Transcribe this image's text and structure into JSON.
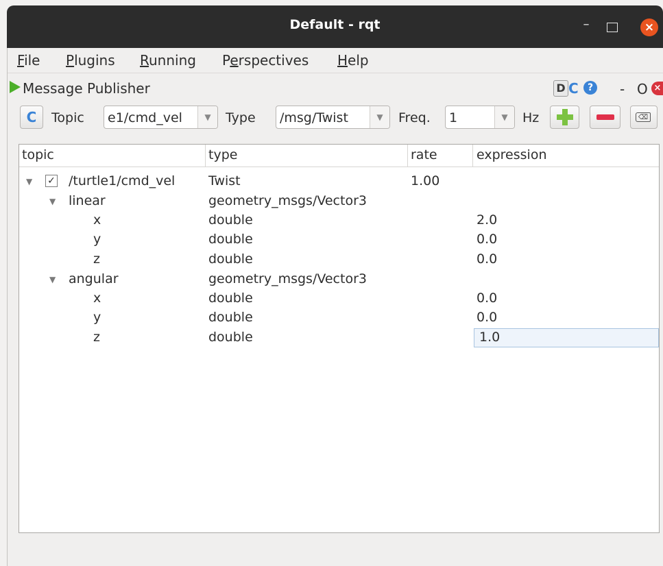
{
  "window": {
    "title": "Default - rqt",
    "controls": {
      "minimize": "–",
      "maximize": "",
      "close": "×"
    }
  },
  "menu": [
    {
      "mnemonic": "F",
      "rest": "ile"
    },
    {
      "mnemonic": "P",
      "rest": "lugins"
    },
    {
      "mnemonic": "R",
      "rest": "unning"
    },
    {
      "pre": "P",
      "mnemonic": "e",
      "rest": "rspectives"
    },
    {
      "mnemonic": "H",
      "rest": "elp"
    }
  ],
  "plugin": {
    "title": "Message Publisher",
    "d_button": "D",
    "reload_glyph": "C",
    "help_glyph": "?",
    "dash": "-",
    "o_letter": "O",
    "close_glyph": "×"
  },
  "toolbar": {
    "refresh_glyph": "C",
    "topic_label": "Topic",
    "topic_value": "e1/cmd_vel",
    "type_label": "Type",
    "type_value": "/msg/Twist",
    "freq_label": "Freq.",
    "freq_value": "1",
    "hz_label": "Hz",
    "dropdown_glyph": "▼",
    "clear_glyph": "⌫"
  },
  "tree": {
    "columns": [
      "topic",
      "type",
      "rate",
      "expression"
    ],
    "rows": [
      {
        "topic": "/turtle1/cmd_vel",
        "type": "Twist",
        "rate": "1.00",
        "expression": "",
        "checked": "✓",
        "twisty": "▼"
      },
      {
        "topic": "linear",
        "type": "geometry_msgs/Vector3",
        "rate": "",
        "expression": "",
        "twisty": "▼"
      },
      {
        "topic": "x",
        "type": "double",
        "rate": "",
        "expression": "2.0"
      },
      {
        "topic": "y",
        "type": "double",
        "rate": "",
        "expression": "0.0"
      },
      {
        "topic": "z",
        "type": "double",
        "rate": "",
        "expression": "0.0"
      },
      {
        "topic": "angular",
        "type": "geometry_msgs/Vector3",
        "rate": "",
        "expression": "",
        "twisty": "▼"
      },
      {
        "topic": "x",
        "type": "double",
        "rate": "",
        "expression": "0.0"
      },
      {
        "topic": "y",
        "type": "double",
        "rate": "",
        "expression": "0.0"
      },
      {
        "topic": "z",
        "type": "double",
        "rate": "",
        "expression": "1.0"
      }
    ]
  },
  "colors": {
    "titlebar": "#2c2c2c",
    "close_button": "#e95420",
    "play_icon": "#4caf2a",
    "add_button": "#7cc242",
    "remove_button": "#e0304a",
    "refresh_icon": "#3a83d6"
  }
}
